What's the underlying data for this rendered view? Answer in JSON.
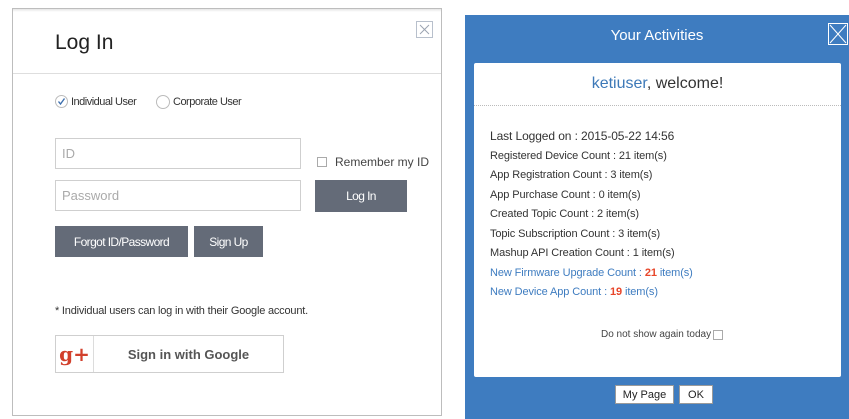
{
  "login": {
    "title": "Log In",
    "radio_individual": "Individual User",
    "radio_corporate": "Corporate User",
    "id_placeholder": "ID",
    "password_placeholder": "Password",
    "remember_label": "Remember my ID",
    "login_button": "Log In",
    "forgot_button": "Forgot ID/Password",
    "signup_button": "Sign Up",
    "google_note": "* Individual users can log in with their Google account.",
    "google_logo": "g+",
    "google_button": "Sign in with Google",
    "colors": {
      "button": "#646b78",
      "google": "#d2402c"
    }
  },
  "activities": {
    "title": "Your Activities",
    "username": "ketiuser",
    "welcome_suffix": ", welcome!",
    "last_logged_label": "Last Logged on : ",
    "last_logged_value": "2015-05-22 14:56",
    "items": [
      "Registered Device Count : 21 item(s)",
      "App Registration Count : 3 item(s)",
      "App Purchase Count : 0 item(s)",
      "Created Topic Count : 2 item(s)",
      "Topic Subscription Count : 3 item(s)",
      "Mashup API Creation Count : 1 item(s)"
    ],
    "firmware_label": "New Firmware Upgrade Count : ",
    "firmware_value": "21",
    "device_app_label": "New Device App Count : ",
    "device_app_value": "19",
    "unit": " item(s)",
    "dont_show": "Do not show again today",
    "mypage_button": "My Page",
    "ok_button": "OK",
    "colors": {
      "panel": "#3e7cc0",
      "highlight": "#e8462a"
    }
  }
}
